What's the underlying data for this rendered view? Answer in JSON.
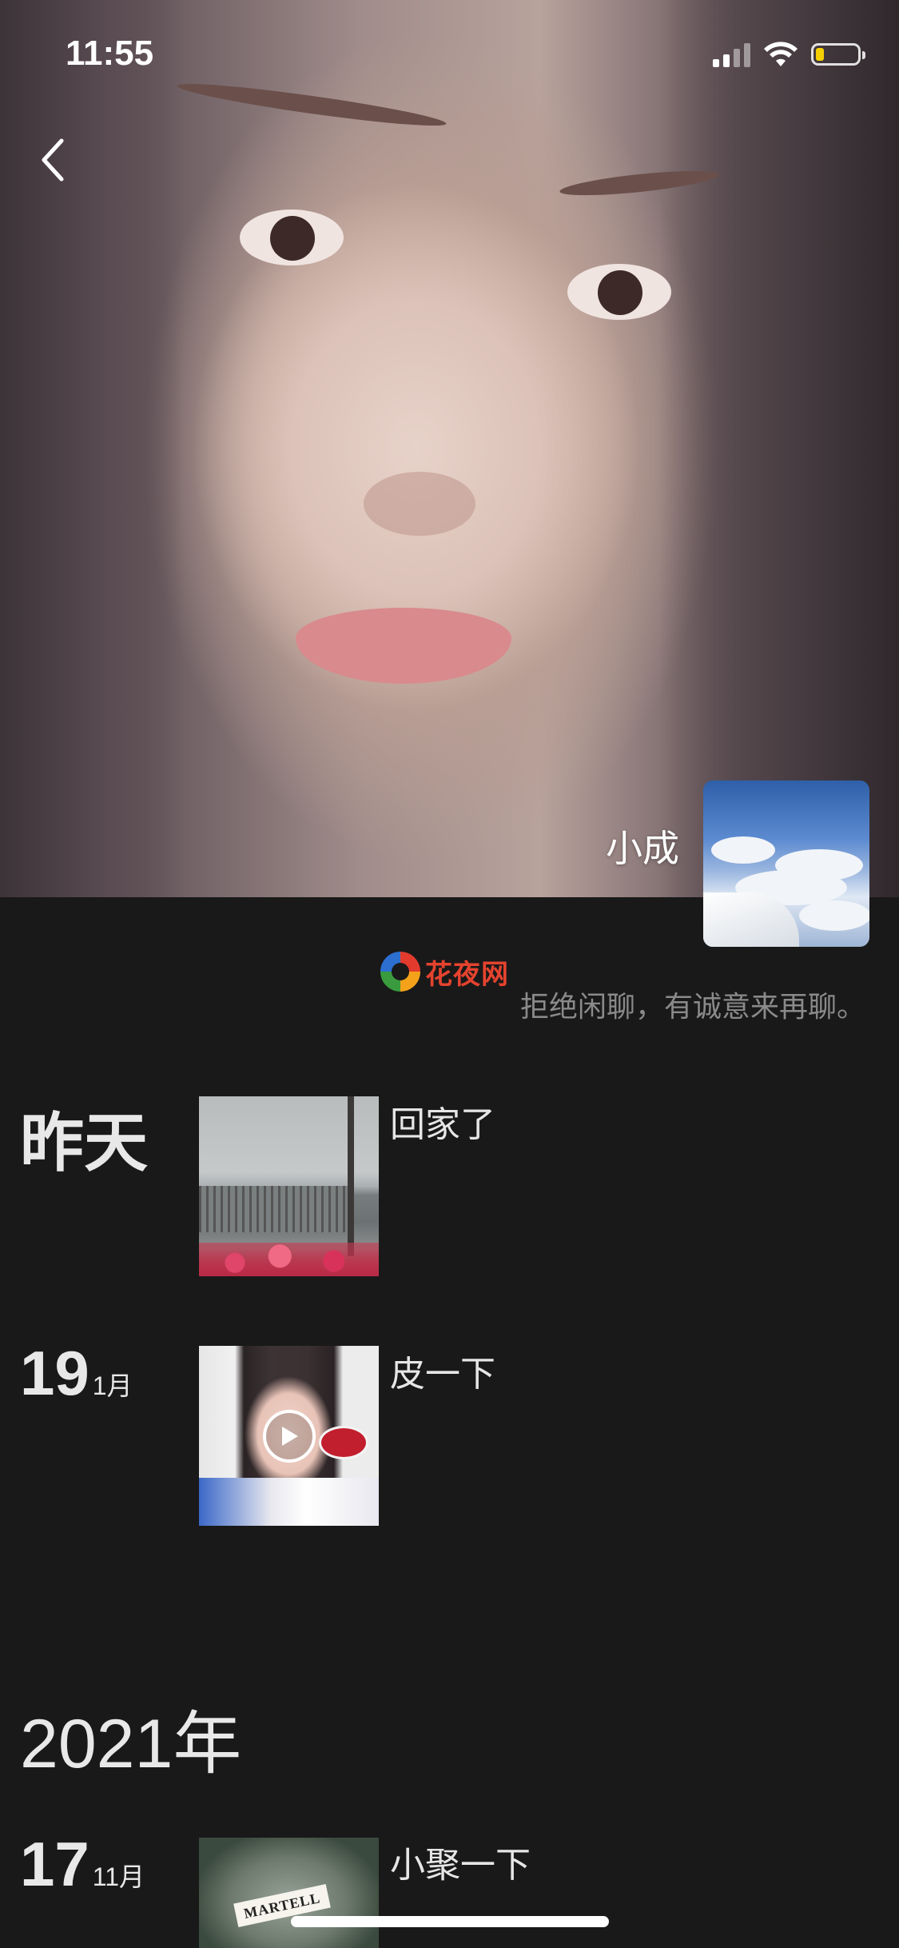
{
  "status_bar": {
    "time": "11:55"
  },
  "profile": {
    "name": "小成",
    "signature": "拒绝闲聊，有诚意来再聊。"
  },
  "watermark": {
    "text": "花夜网"
  },
  "moments": [
    {
      "date_label": "昨天",
      "text": "回家了"
    },
    {
      "day": "19",
      "month": "1月",
      "text": "皮一下"
    }
  ],
  "year_heading": "2021年",
  "moments_2021": [
    {
      "day": "17",
      "month": "11月",
      "text": "小聚一下",
      "thumb_label": "MARTELL"
    }
  ],
  "colors": {
    "background": "#191919",
    "text_primary": "#e8e8e8",
    "text_secondary": "#8a8a8a",
    "battery_level": "#f5d000",
    "watermark": "#e5432f"
  }
}
